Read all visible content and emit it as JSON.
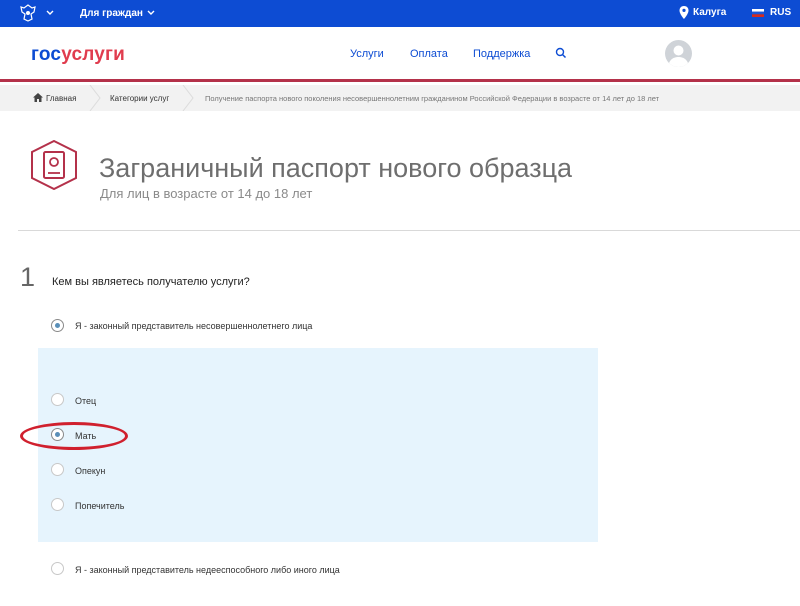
{
  "topbar": {
    "citizens_label": "Для граждан",
    "city": "Калуга",
    "language": "RUS",
    "icons": {
      "emblem": "coat-of-arms-icon",
      "location": "location-pin-icon",
      "flag": "russia-flag-icon"
    }
  },
  "header": {
    "logo_part1": "гос",
    "logo_part2": "услуги",
    "nav": [
      "Услуги",
      "Оплата",
      "Поддержка"
    ],
    "search_icon": "search-icon"
  },
  "breadcrumbs": [
    "Главная",
    "Категории услуг",
    "Получение паспорта нового поколения несовершеннолетним гражданином Российской Федерации в возрасте от 14 лет до 18 лет"
  ],
  "service": {
    "title": "Заграничный паспорт нового образца",
    "subtitle": "Для лиц в возрасте от 14 до 18 лет",
    "icon": "passport-icon"
  },
  "question": {
    "number": "1",
    "text": "Кем вы являетесь получателю услуги?",
    "options": [
      {
        "label": "Я - законный представитель несовершеннолетнего лица",
        "selected": true
      },
      {
        "label": "Я - законный представитель недееспособного либо иного лица",
        "selected": false
      }
    ],
    "sub_options": [
      {
        "label": "Отец",
        "selected": false
      },
      {
        "label": "Мать",
        "selected": true
      },
      {
        "label": "Опекун",
        "selected": false
      },
      {
        "label": "Попечитель",
        "selected": false
      }
    ]
  },
  "colors": {
    "topbar": "#0d4cd3",
    "brand_blue": "#0d4cd3",
    "brand_red": "#e03c4e",
    "header_border": "#b4314a",
    "subpanel": "#e6f4fd",
    "annotation": "#d0202e"
  }
}
